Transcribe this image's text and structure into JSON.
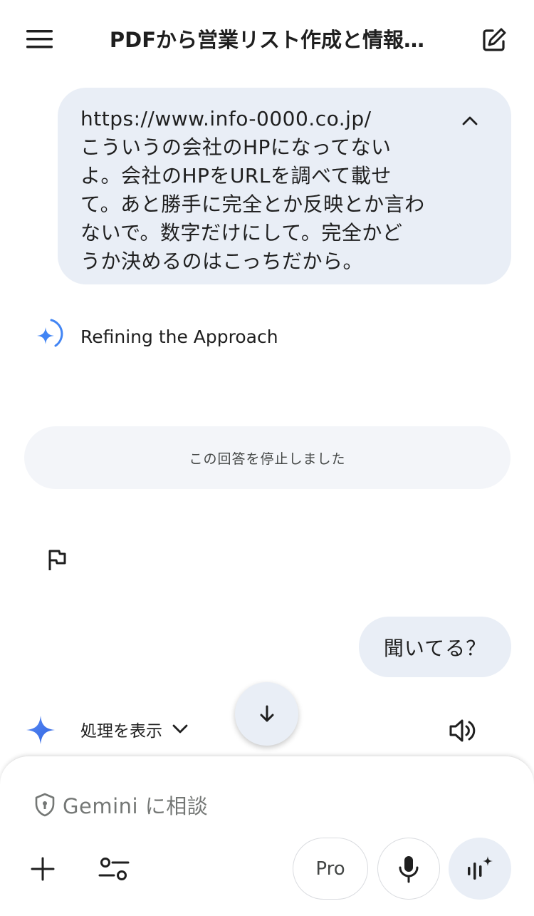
{
  "header": {
    "title": "PDFから営業リスト作成と情報…"
  },
  "messages": {
    "user_1": "https://www.info-0000.co.jp/\nこういうの会社のHPになってない\nよ。会社のHPをURLを調べて載せ\nて。あと勝手に完全とか反映とか言わ\nないで。数字だけにして。完全かど\nうか決めるのはこっちだから。",
    "thinking_label": "Refining the Approach",
    "stopped_notice": "この回答を停止しました",
    "user_2": "聞いてる？",
    "show_process_label": "処理を表示"
  },
  "composer": {
    "placeholder": "Gemini に相談",
    "model_label": "Pro"
  },
  "colors": {
    "bubble": "#e9eef6",
    "gemini_blue": "#4285f4",
    "text": "#1f1f1f"
  },
  "icons": [
    "menu-icon",
    "edit-icon",
    "chevron-up-icon",
    "gemini-spark-icon",
    "flag-icon",
    "chevron-down-icon",
    "speaker-icon",
    "arrow-down-icon",
    "shield-icon",
    "plus-icon",
    "tune-icon",
    "mic-icon",
    "live-icon"
  ]
}
